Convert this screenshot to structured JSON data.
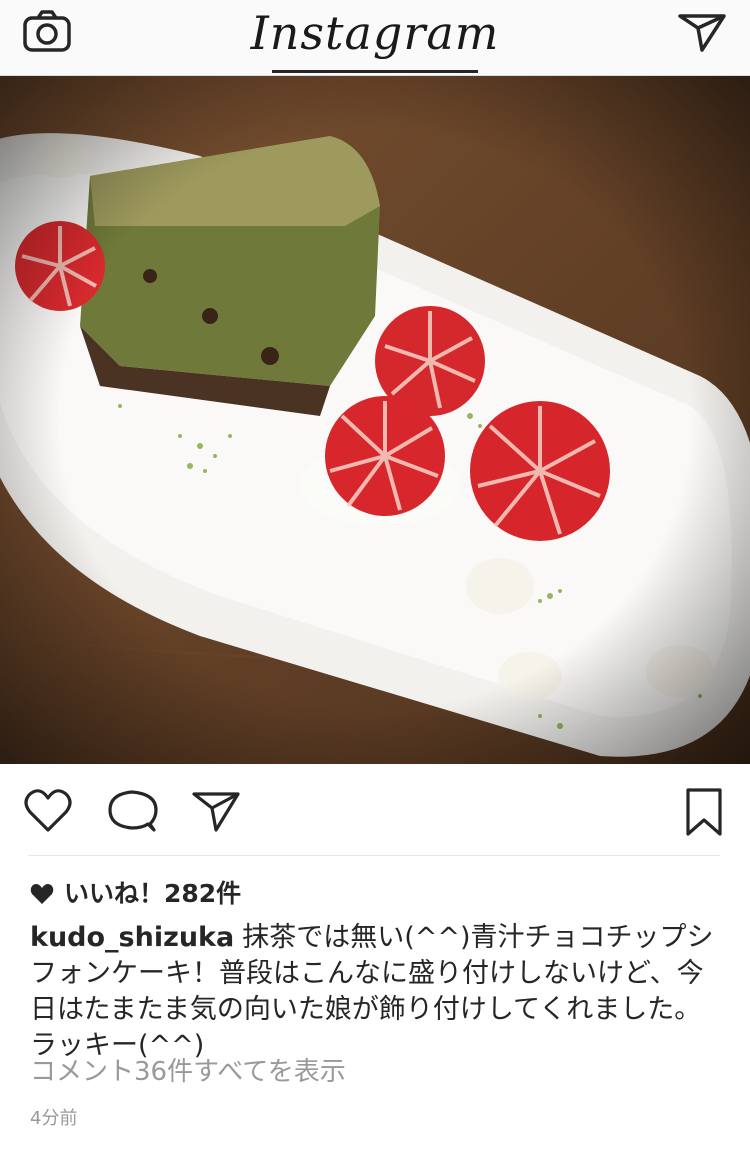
{
  "header": {
    "logo": "Instagram",
    "icons": [
      "camera-icon",
      "direct-send-icon"
    ]
  },
  "post": {
    "image_alt": "matcha-style green chiffon cake with strawberries on a white plate",
    "actions": [
      "heart-icon",
      "comment-icon",
      "share-icon",
      "bookmark-icon"
    ],
    "likes_label": "いいね！282件",
    "username": "kudo_shizuka",
    "caption": "抹茶では無い(^^)青汁チョコチップシフォンケーキ！普段はこんなに盛り付けしないけど、今日はたまたま気の向いた娘が飾り付けしてくれました。ラッキー(^^)",
    "view_comments": "コメント36件すべてを表示",
    "timestamp": "4分前"
  },
  "colors": {
    "text": "#262626",
    "muted": "#999999",
    "bar_bg": "#fafafa"
  }
}
